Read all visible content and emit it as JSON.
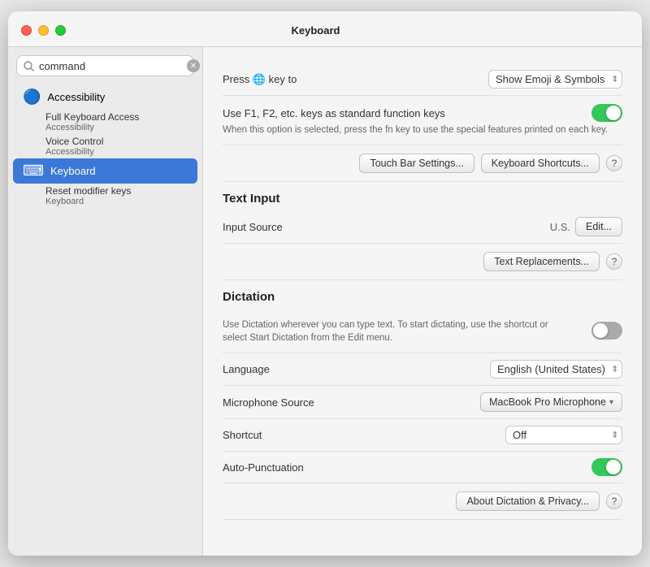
{
  "window": {
    "title": "Keyboard"
  },
  "sidebar": {
    "search_placeholder": "command",
    "items": [
      {
        "id": "accessibility",
        "icon": "♿",
        "label": "Accessibility",
        "sub_items": [
          {
            "label": "Full Keyboard Access",
            "category": "Accessibility"
          },
          {
            "label": "Voice Control",
            "category": "Accessibility"
          }
        ]
      },
      {
        "id": "keyboard",
        "icon": "⌨",
        "label": "Keyboard",
        "selected": true,
        "sub_items": [
          {
            "label": "Reset modifier keys",
            "category": "Keyboard"
          }
        ]
      }
    ]
  },
  "main": {
    "press_key_label": "Press",
    "press_key_globe": "🌐",
    "press_key_suffix": "key to",
    "press_key_value": "Show Emoji & Symbols",
    "function_keys_title": "Use F1, F2, etc. keys as standard function keys",
    "function_keys_description": "When this option is selected, press the fn key to use the special features printed on each key.",
    "function_keys_toggle": true,
    "touch_bar_button": "Touch Bar Settings...",
    "keyboard_shortcuts_button": "Keyboard Shortcuts...",
    "text_input_header": "Text Input",
    "input_source_label": "Input Source",
    "input_source_value": "U.S.",
    "edit_button": "Edit...",
    "text_replacements_button": "Text Replacements...",
    "dictation_header": "Dictation",
    "dictation_description": "Use Dictation wherever you can type text. To start dictating, use the shortcut or select Start Dictation from the Edit menu.",
    "dictation_toggle": false,
    "language_label": "Language",
    "language_value": "English (United States)",
    "microphone_label": "Microphone Source",
    "microphone_value": "MacBook Pro Microphone",
    "shortcut_label": "Shortcut",
    "shortcut_value": "Off",
    "auto_punctuation_label": "Auto-Punctuation",
    "auto_punctuation_toggle": true,
    "about_dictation_button": "About Dictation & Privacy...",
    "help_label": "?"
  }
}
